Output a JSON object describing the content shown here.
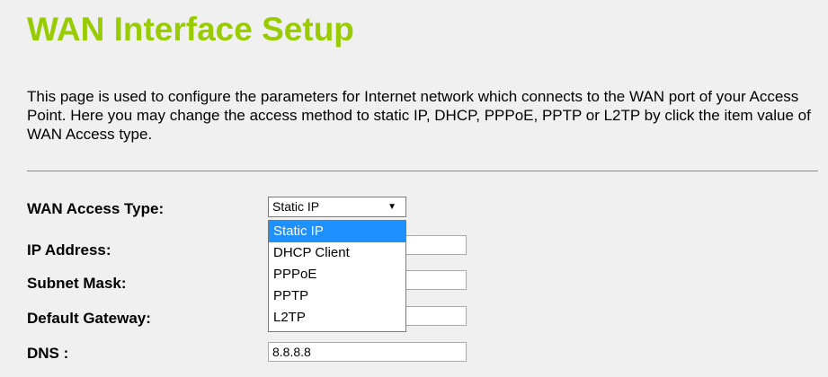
{
  "page": {
    "title": "WAN Interface Setup",
    "description": "This page is used to configure the parameters for Internet network which connects to the WAN port of your Access Point. Here you may change the access method to static IP, DHCP, PPPoE, PPTP or L2TP by click the item value of WAN Access type."
  },
  "form": {
    "wan_access_type_label": "WAN Access Type:",
    "wan_access_type_value": "Static IP",
    "ip_address_label": "IP Address:",
    "ip_address_value": "",
    "subnet_mask_label": "Subnet Mask:",
    "subnet_mask_value": "",
    "default_gateway_label": "Default Gateway:",
    "default_gateway_value": "",
    "dns_label": "DNS :",
    "dns_value": "8.8.8.8"
  },
  "dropdown": {
    "options": [
      "Static IP",
      "DHCP Client",
      "PPPoE",
      "PPTP",
      "L2TP"
    ],
    "highlighted": "Static IP"
  },
  "colors": {
    "title": "#99cc00",
    "highlight": "#1e90ff",
    "background": "#f0f0f0"
  },
  "icons": {
    "select_arrow": "triangle-down"
  }
}
